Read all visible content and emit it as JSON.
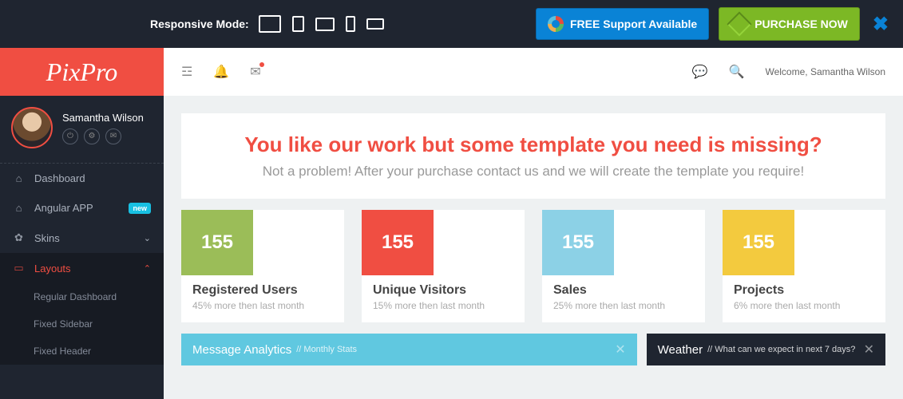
{
  "topbar": {
    "responsive_label": "Responsive Mode:",
    "support_label": "FREE Support Available",
    "purchase_label": "PURCHASE NOW"
  },
  "logo": "PixPro",
  "user": {
    "name": "Samantha Wilson"
  },
  "nav": {
    "dashboard": "Dashboard",
    "angular": "Angular APP",
    "angular_badge": "new",
    "skins": "Skins",
    "layouts": "Layouts",
    "sub": {
      "regular": "Regular Dashboard",
      "fixed_sidebar": "Fixed Sidebar",
      "fixed_header": "Fixed Header"
    }
  },
  "header": {
    "welcome": "Welcome, Samantha Wilson"
  },
  "promo": {
    "title": "You like our work but some template you need is missing?",
    "sub": "Not a problem! After your purchase contact us and we will create the template you require!"
  },
  "stats": [
    {
      "value": "155",
      "title": "Registered Users",
      "sub": "45% more then last month",
      "color": "c-green"
    },
    {
      "value": "155",
      "title": "Unique Visitors",
      "sub": "15% more then last month",
      "color": "c-red"
    },
    {
      "value": "155",
      "title": "Sales",
      "sub": "25% more then last month",
      "color": "c-blue"
    },
    {
      "value": "155",
      "title": "Projects",
      "sub": "6% more then last month",
      "color": "c-yellow"
    }
  ],
  "panels": {
    "analytics_title": "Message Analytics",
    "analytics_sub": "// Monthly Stats",
    "weather_title": "Weather",
    "weather_sub": "// What can we expect in next 7 days?"
  }
}
